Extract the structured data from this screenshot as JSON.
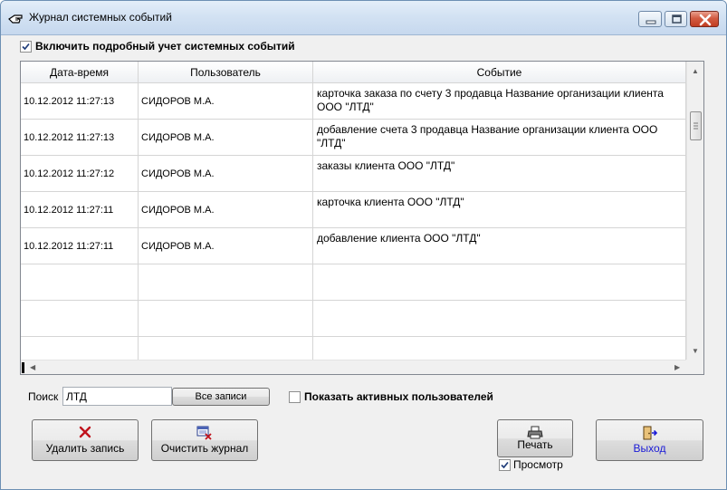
{
  "window": {
    "title": "Журнал системных событий"
  },
  "options": {
    "detailed_log_label": "Включить подробный учет системных событий",
    "detailed_log_checked": true,
    "show_active_label": "Показать активных пользователей",
    "show_active_checked": false,
    "preview_label": "Просмотр",
    "preview_checked": true
  },
  "grid": {
    "columns": [
      "Дата-время",
      "Пользователь",
      "Событие"
    ],
    "rows": [
      {
        "date": "10.12.2012 11:27:13",
        "user": "СИДОРОВ М.А.",
        "event": "карточка заказа по счету 3 продавца Название организации клиента ООО \"ЛТД\""
      },
      {
        "date": "10.12.2012 11:27:13",
        "user": "СИДОРОВ М.А.",
        "event": "добавление счета 3 продавца Название организации клиента ООО \"ЛТД\""
      },
      {
        "date": "10.12.2012 11:27:12",
        "user": "СИДОРОВ М.А.",
        "event": "заказы клиента ООО \"ЛТД\""
      },
      {
        "date": "10.12.2012 11:27:11",
        "user": "СИДОРОВ М.А.",
        "event": "карточка клиента ООО \"ЛТД\""
      },
      {
        "date": "10.12.2012 11:27:11",
        "user": "СИДОРОВ М.А.",
        "event": "добавление клиента ООО \"ЛТД\""
      },
      {
        "date": "",
        "user": "",
        "event": ""
      },
      {
        "date": "",
        "user": "",
        "event": ""
      },
      {
        "date": "",
        "user": "",
        "event": ""
      }
    ]
  },
  "search": {
    "label": "Поиск",
    "value": "ЛТД",
    "all_records_label": "Все записи"
  },
  "buttons": {
    "delete_label": "Удалить запись",
    "clear_label": "Очистить журнал",
    "print_label": "Печать",
    "exit_label": "Выход"
  },
  "icons": {
    "app": "hand-pointer-icon",
    "delete": "red-x-icon",
    "clear": "clear-log-icon",
    "print": "printer-icon",
    "exit": "exit-door-icon"
  },
  "colors": {
    "titlebar": "#d3e2f3",
    "close_button": "#c23e23",
    "exit_label": "#1a1ad6",
    "delete_icon": "#c0121c"
  }
}
